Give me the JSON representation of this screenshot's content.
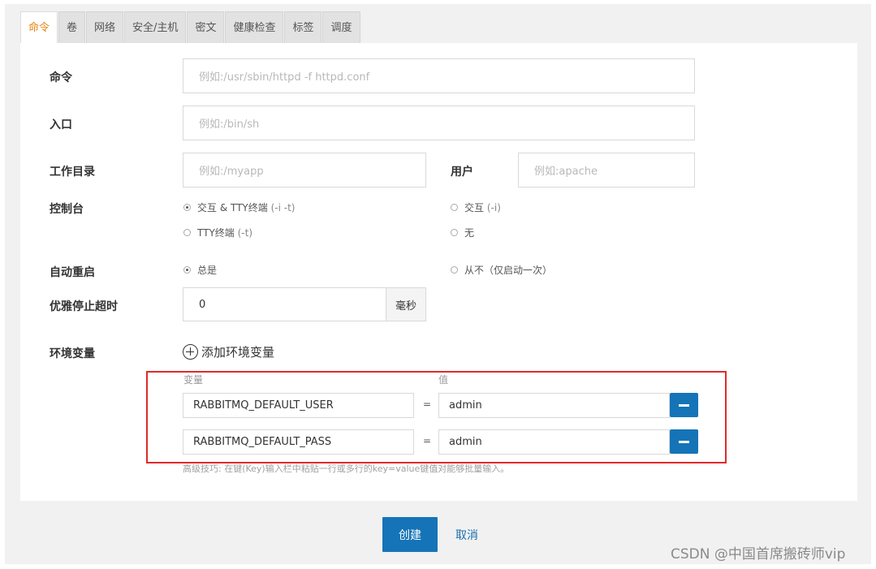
{
  "tabs": [
    "命令",
    "卷",
    "网络",
    "安全/主机",
    "密文",
    "健康检查",
    "标签",
    "调度"
  ],
  "form": {
    "command": {
      "label": "命令",
      "placeholder": "例如:/usr/sbin/httpd -f httpd.conf"
    },
    "entrypoint": {
      "label": "入口",
      "placeholder": "例如:/bin/sh"
    },
    "workdir": {
      "label": "工作目录",
      "placeholder": "例如:/myapp"
    },
    "user": {
      "label": "用户",
      "placeholder": "例如:apache"
    },
    "console": {
      "label": "控制台",
      "options": [
        {
          "text": "交互 & TTY终端",
          "flag": "(-i -t)",
          "selected": true
        },
        {
          "text": "交互",
          "flag": "(-i)",
          "selected": false
        },
        {
          "text": "TTY终端",
          "flag": "(-t)",
          "selected": false
        },
        {
          "text": "无",
          "flag": "",
          "selected": false
        }
      ]
    },
    "restart": {
      "label": "自动重启",
      "options": [
        {
          "text": "总是",
          "selected": true
        },
        {
          "text": "从不（仅启动一次）",
          "selected": false
        }
      ]
    },
    "graceful_stop": {
      "label": "优雅停止超时",
      "value": "0",
      "unit": "毫秒"
    },
    "env": {
      "label": "环境变量",
      "add_label": "添加环境变量",
      "key_header": "变量",
      "value_header": "值",
      "equals": "=",
      "rows": [
        {
          "key": "RABBITMQ_DEFAULT_USER",
          "value": "admin"
        },
        {
          "key": "RABBITMQ_DEFAULT_PASS",
          "value": "admin"
        }
      ],
      "hint": "高级技巧: 在键(Key)输入栏中粘贴一行或多行的key=value键值对能够批量输入。"
    }
  },
  "actions": {
    "create": "创建",
    "cancel": "取消"
  },
  "watermark": "CSDN @中国首席搬砖师vip",
  "colors": {
    "accent": "#1574b7",
    "active_tab": "#e8830e",
    "highlight_box": "#e02a2a"
  }
}
